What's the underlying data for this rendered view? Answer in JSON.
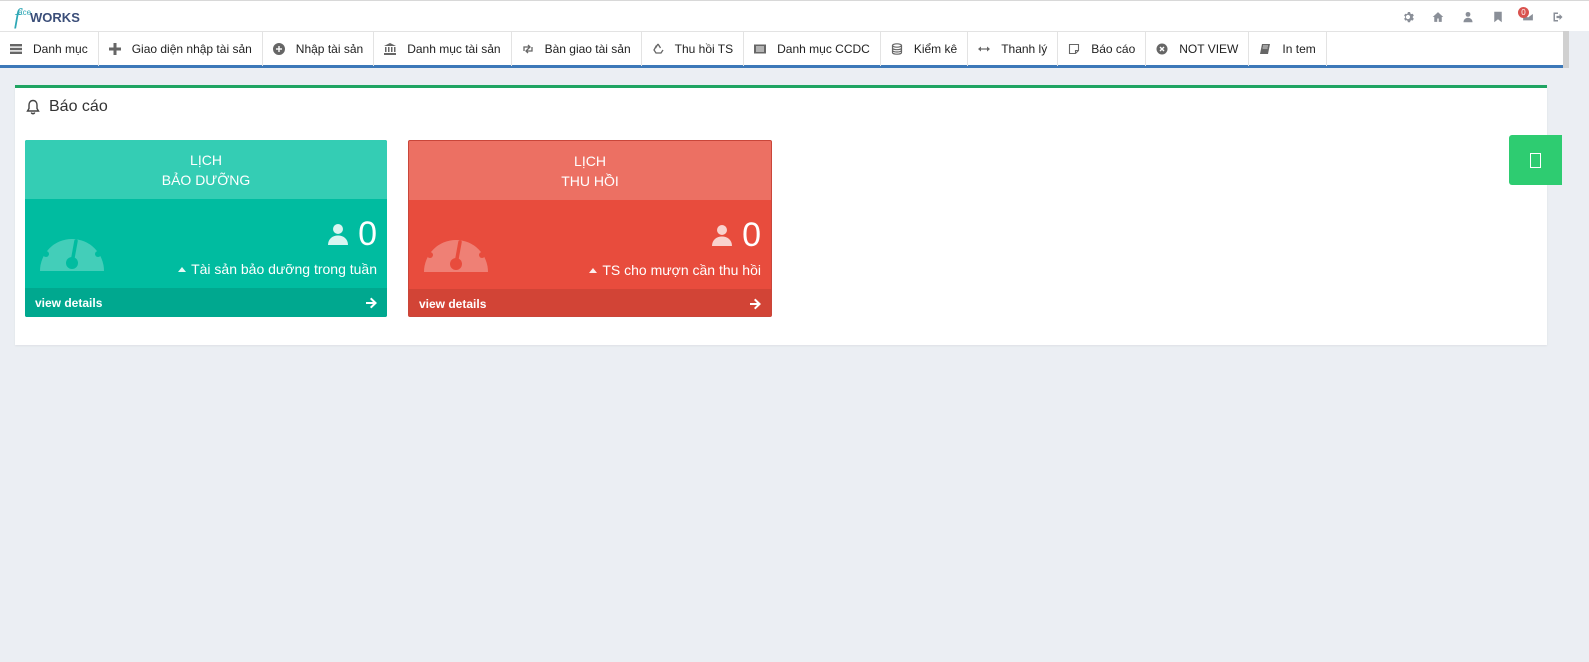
{
  "app": {
    "logo": {
      "f": "f",
      "ace": "ace",
      "works": "WORKS"
    },
    "top_icons": [
      "gear-icon",
      "home-icon",
      "user-icon",
      "bookmark-icon",
      "mail-icon",
      "logout-icon"
    ],
    "mail_badge": "0"
  },
  "nav": {
    "items": [
      {
        "label": "Danh mục",
        "icon": "menu-icon"
      },
      {
        "label": "Giao diện nhập tài sản",
        "icon": "plus-icon"
      },
      {
        "label": "Nhập tài sản",
        "icon": "plus-circle-icon"
      },
      {
        "label": "Danh mục tài sản",
        "icon": "bank-icon"
      },
      {
        "label": "Bàn giao tài sản",
        "icon": "retweet-icon"
      },
      {
        "label": "Thu hồi TS",
        "icon": "recycle-icon"
      },
      {
        "label": "Danh mục CCDC",
        "icon": "list-icon"
      },
      {
        "label": "Kiểm kê",
        "icon": "database-icon"
      },
      {
        "label": "Thanh lý",
        "icon": "arrows-h-icon"
      },
      {
        "label": "Báo cáo",
        "icon": "note-icon"
      },
      {
        "label": "NOT VIEW",
        "icon": "close-circle-icon"
      },
      {
        "label": "In tem",
        "icon": "book-icon"
      }
    ]
  },
  "panel": {
    "title": "Báo cáo",
    "cards": [
      {
        "title_line1": "LỊCH",
        "title_line2": "BẢO DƯỠNG",
        "count": "0",
        "subtext": "Tài sản bảo dưỡng trong tuần",
        "footer": "view details",
        "color": "#00bca0"
      },
      {
        "title_line1": "LỊCH",
        "title_line2": "THU HỒI",
        "count": "0",
        "subtext": "TS cho mượn cần thu hồi",
        "footer": "view details",
        "color": "#e84c3d"
      }
    ]
  },
  "colors": {
    "accent_blue": "#3c78b8",
    "panel_border": "#1fa462",
    "side_tab": "#2ecc71"
  }
}
